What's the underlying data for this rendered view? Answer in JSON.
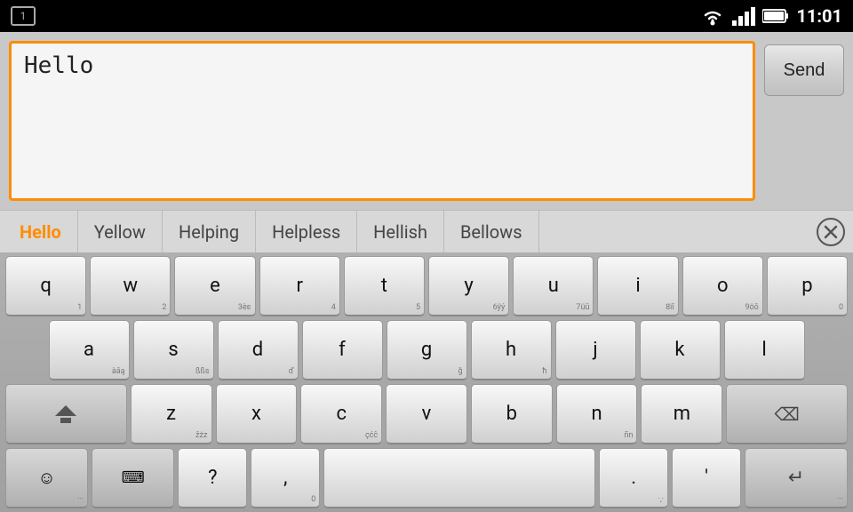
{
  "statusBar": {
    "notification": "1",
    "time": "11:01"
  },
  "inputArea": {
    "textValue": "Hello",
    "sendLabel": "Send"
  },
  "suggestions": {
    "items": [
      {
        "label": "Hello",
        "active": true
      },
      {
        "label": "Yellow",
        "active": false
      },
      {
        "label": "Helping",
        "active": false
      },
      {
        "label": "Helpless",
        "active": false
      },
      {
        "label": "Hellish",
        "active": false
      },
      {
        "label": "Bellows",
        "active": false
      }
    ],
    "closeLabel": "✕"
  },
  "keyboard": {
    "row1": [
      {
        "main": "q",
        "sub": "1"
      },
      {
        "main": "w",
        "sub": "2"
      },
      {
        "main": "e",
        "sub": "3єε"
      },
      {
        "main": "r",
        "sub": "4"
      },
      {
        "main": "t",
        "sub": "5"
      },
      {
        "main": "y",
        "sub": "6ÿý"
      },
      {
        "main": "u",
        "sub": "7üū"
      },
      {
        "main": "i",
        "sub": "8ïī"
      },
      {
        "main": "o",
        "sub": "9öō"
      },
      {
        "main": "p",
        "sub": "0"
      }
    ],
    "row2": [
      {
        "main": "a",
        "sub": "àāą"
      },
      {
        "main": "s",
        "sub": "ßßs"
      },
      {
        "main": "d",
        "sub": "ď"
      },
      {
        "main": "f",
        "sub": ""
      },
      {
        "main": "g",
        "sub": "ğ"
      },
      {
        "main": "h",
        "sub": "ħ"
      },
      {
        "main": "j",
        "sub": ""
      },
      {
        "main": "k",
        "sub": ""
      },
      {
        "main": "l",
        "sub": ""
      }
    ],
    "row3": [
      {
        "main": "z",
        "sub": "žżz"
      },
      {
        "main": "x",
        "sub": ""
      },
      {
        "main": "c",
        "sub": "çćĉ"
      },
      {
        "main": "v",
        "sub": ""
      },
      {
        "main": "b",
        "sub": ""
      },
      {
        "main": "n",
        "sub": "ñn"
      },
      {
        "main": "m",
        "sub": ""
      }
    ],
    "row4": [
      {
        "main": "?",
        "sub": ""
      },
      {
        "main": ",",
        "sub": "0"
      },
      {
        "main": ".",
        "sub": "·,·"
      },
      {
        "main": "'",
        "sub": ""
      }
    ]
  }
}
